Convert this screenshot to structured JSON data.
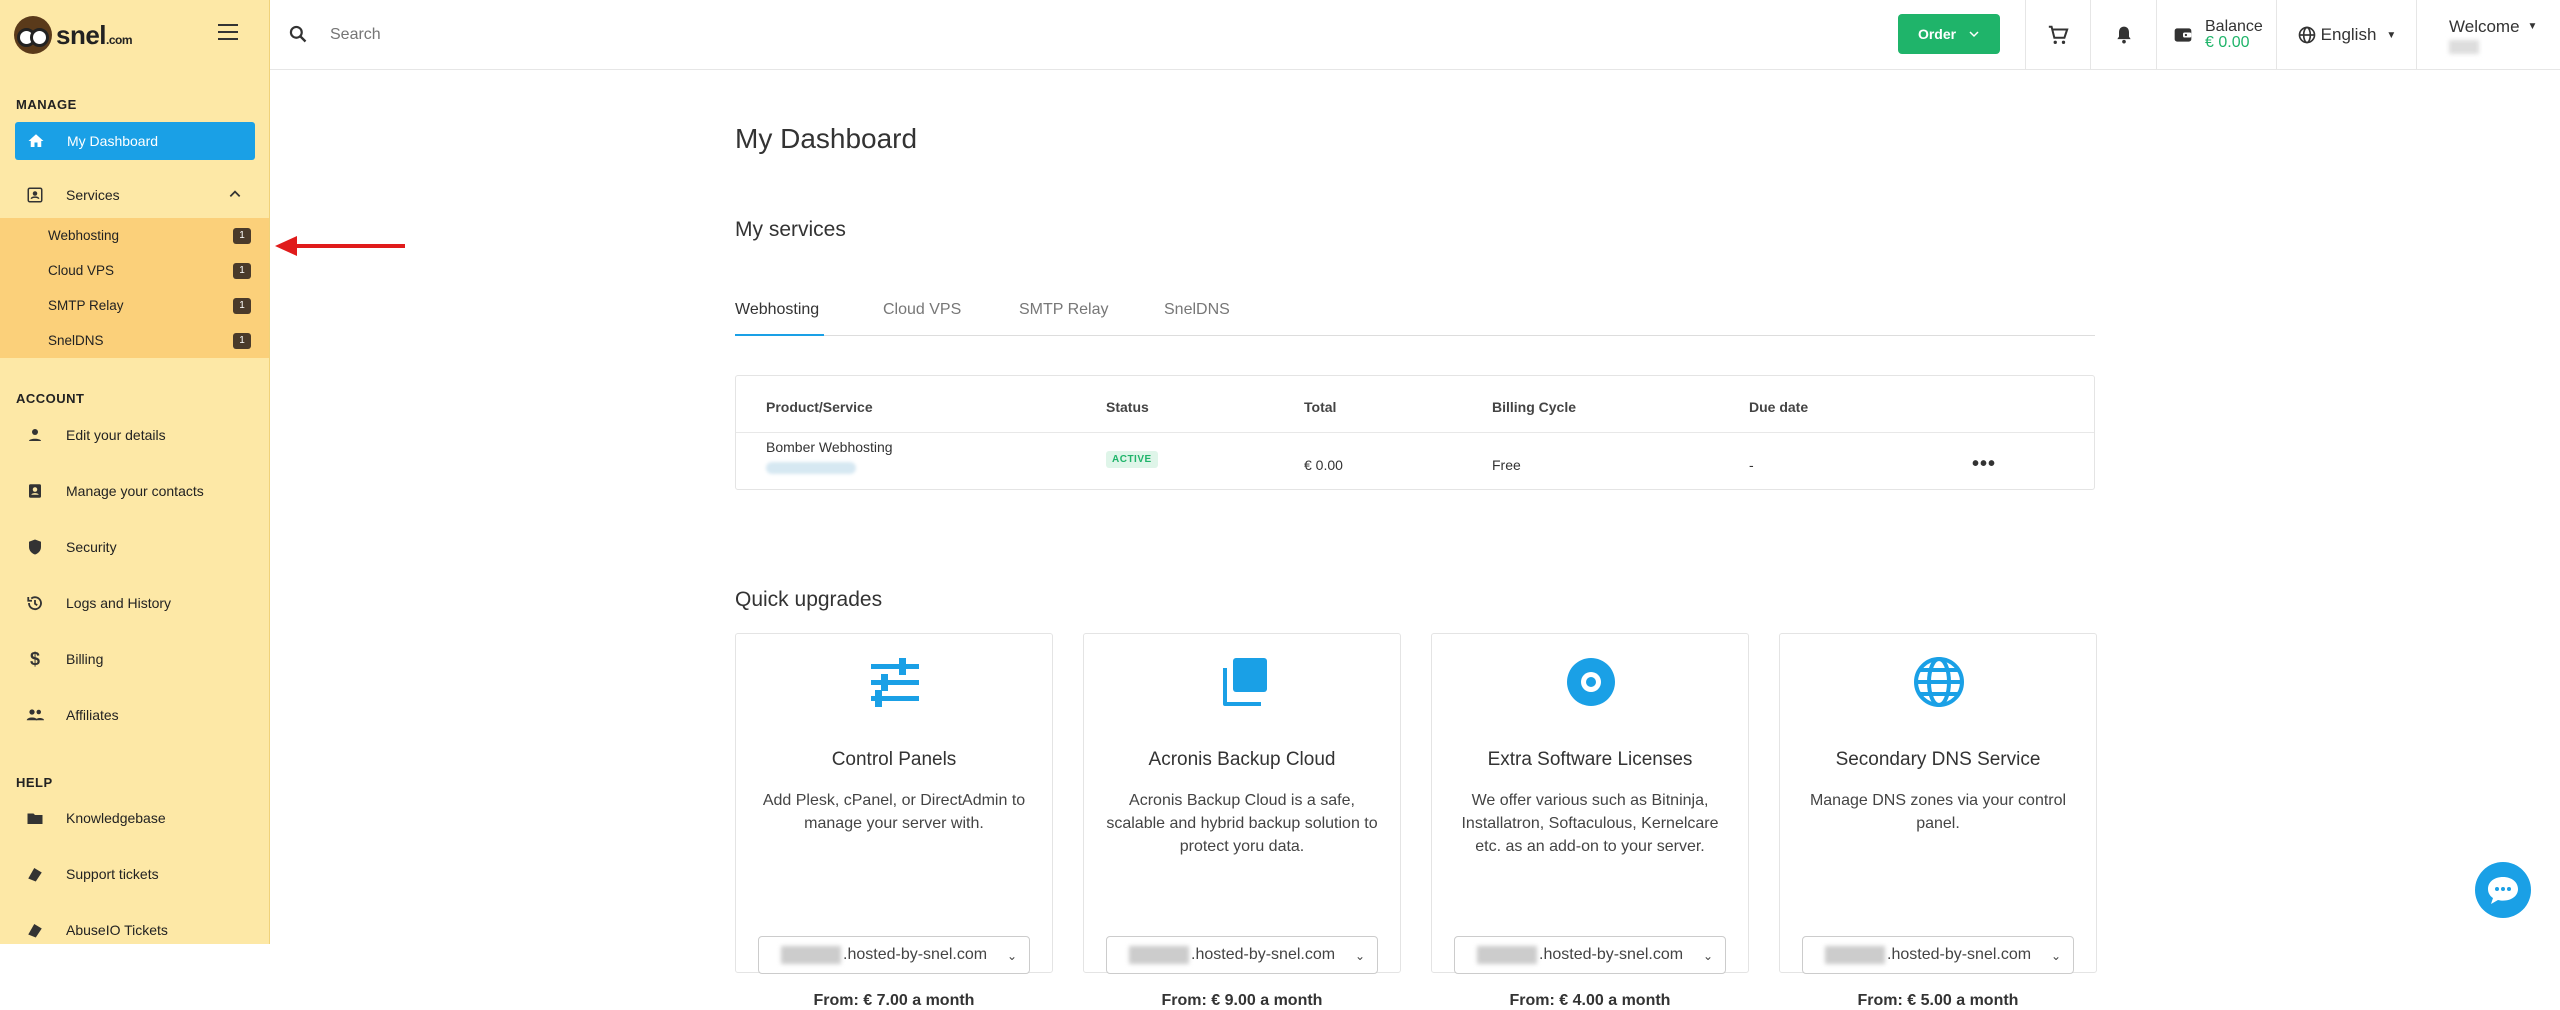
{
  "logo": {
    "text": "snel",
    "suffix": ".com"
  },
  "sidebar": {
    "manage_title": "MANAGE",
    "dashboard_label": "My Dashboard",
    "services_label": "Services",
    "services_sub": [
      {
        "label": "Webhosting",
        "count": "1"
      },
      {
        "label": "Cloud VPS",
        "count": "1"
      },
      {
        "label": "SMTP Relay",
        "count": "1"
      },
      {
        "label": "SnelDNS",
        "count": "1"
      }
    ],
    "account_title": "ACCOUNT",
    "account_items": [
      "Edit your details",
      "Manage your contacts",
      "Security",
      "Logs and History",
      "Billing",
      "Affiliates"
    ],
    "help_title": "HELP",
    "help_items": [
      "Knowledgebase",
      "Support tickets",
      "AbuseIO Tickets"
    ]
  },
  "topbar": {
    "search_placeholder": "Search",
    "order_label": "Order",
    "balance_label": "Balance",
    "balance_value": "€ 0.00",
    "language": "English",
    "welcome": "Welcome"
  },
  "main": {
    "title": "My Dashboard",
    "services_title": "My services",
    "tabs": [
      "Webhosting",
      "Cloud VPS",
      "SMTP Relay",
      "SnelDNS"
    ],
    "table": {
      "headers": [
        "Product/Service",
        "Status",
        "Total",
        "Billing Cycle",
        "Due date"
      ],
      "row": {
        "product": "Bomber Webhosting",
        "status": "ACTIVE",
        "total": "€ 0.00",
        "cycle": "Free",
        "due": "-"
      }
    },
    "upgrades_title": "Quick upgrades",
    "cards": [
      {
        "title": "Control Panels",
        "desc": "Add Plesk, cPanel, or DirectAdmin to manage your server with.",
        "select": ".hosted-by-snel.com",
        "price": "From: € 7.00 a month",
        "icon": "sliders-icon"
      },
      {
        "title": "Acronis Backup Cloud",
        "desc": "Acronis Backup Cloud is a safe, scalable and hybrid backup solution to protect yoru data.",
        "select": ".hosted-by-snel.com",
        "price": "From: € 9.00 a month",
        "icon": "copy-icon"
      },
      {
        "title": "Extra Software Licenses",
        "desc": "We offer various such as Bitninja, Installatron, Softaculous, Kernelcare etc. as an add-on to your server.",
        "select": ".hosted-by-snel.com",
        "price": "From: € 4.00 a month",
        "icon": "disc-icon"
      },
      {
        "title": "Secondary DNS Service",
        "desc": "Manage DNS zones via your control panel.",
        "select": ".hosted-by-snel.com",
        "price": "From: € 5.00 a month",
        "icon": "globe-icon"
      }
    ]
  },
  "colors": {
    "accent": "#1aa0e6",
    "green": "#1fb46a",
    "sidebar": "#fde8a6",
    "sub": "#fbd07a",
    "arrow": "#e01b1b"
  }
}
